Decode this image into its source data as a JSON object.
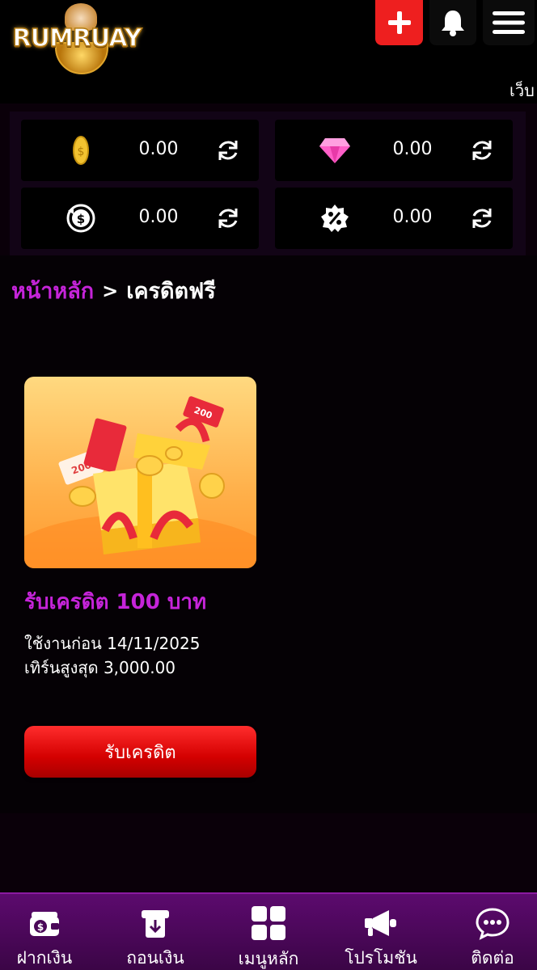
{
  "header": {
    "logo_text": "RUMRUAY",
    "marquee_text": "เว็บ"
  },
  "wallet": {
    "items": [
      {
        "icon": "coin-icon",
        "value": "0.00"
      },
      {
        "icon": "diamond-icon",
        "value": "0.00"
      },
      {
        "icon": "cashback-icon",
        "value": "0.00"
      },
      {
        "icon": "percent-badge-icon",
        "value": "0.00"
      }
    ]
  },
  "breadcrumb": {
    "home": "หน้าหลัก",
    "separator": ">",
    "current": "เครดิตฟรี"
  },
  "promo": {
    "title": "รับเครดิต 100 บาท",
    "expiry": "ใช้งานก่อน 14/11/2025",
    "max_withdraw": "เทิร์นสูงสุด 3,000.00",
    "button_label": "รับเครดิต",
    "ticket_label": "200"
  },
  "bottom_nav": {
    "items": [
      {
        "label": "ฝากเงิน",
        "icon": "deposit-icon"
      },
      {
        "label": "ถอนเงิน",
        "icon": "withdraw-icon"
      },
      {
        "label": "เมนูหลัก",
        "icon": "grid-icon"
      },
      {
        "label": "โปรโมชัน",
        "icon": "megaphone-icon"
      },
      {
        "label": "ติดต่อ",
        "icon": "chat-icon"
      }
    ]
  },
  "colors": {
    "accent": "#c524d9",
    "button_red": "#ee1f1f",
    "nav_bg": "#4a0858",
    "background": "#0a0009"
  }
}
